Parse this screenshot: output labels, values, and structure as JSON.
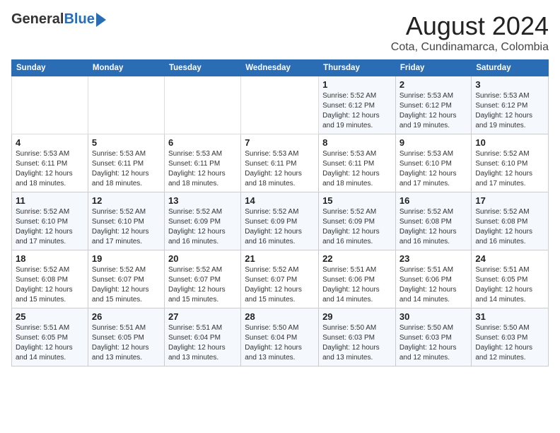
{
  "header": {
    "logo_general": "General",
    "logo_blue": "Blue",
    "title": "August 2024",
    "subtitle": "Cota, Cundinamarca, Colombia"
  },
  "weekdays": [
    "Sunday",
    "Monday",
    "Tuesday",
    "Wednesday",
    "Thursday",
    "Friday",
    "Saturday"
  ],
  "weeks": [
    [
      {
        "day": "",
        "detail": ""
      },
      {
        "day": "",
        "detail": ""
      },
      {
        "day": "",
        "detail": ""
      },
      {
        "day": "",
        "detail": ""
      },
      {
        "day": "1",
        "detail": "Sunrise: 5:52 AM\nSunset: 6:12 PM\nDaylight: 12 hours\nand 19 minutes."
      },
      {
        "day": "2",
        "detail": "Sunrise: 5:53 AM\nSunset: 6:12 PM\nDaylight: 12 hours\nand 19 minutes."
      },
      {
        "day": "3",
        "detail": "Sunrise: 5:53 AM\nSunset: 6:12 PM\nDaylight: 12 hours\nand 19 minutes."
      }
    ],
    [
      {
        "day": "4",
        "detail": "Sunrise: 5:53 AM\nSunset: 6:11 PM\nDaylight: 12 hours\nand 18 minutes."
      },
      {
        "day": "5",
        "detail": "Sunrise: 5:53 AM\nSunset: 6:11 PM\nDaylight: 12 hours\nand 18 minutes."
      },
      {
        "day": "6",
        "detail": "Sunrise: 5:53 AM\nSunset: 6:11 PM\nDaylight: 12 hours\nand 18 minutes."
      },
      {
        "day": "7",
        "detail": "Sunrise: 5:53 AM\nSunset: 6:11 PM\nDaylight: 12 hours\nand 18 minutes."
      },
      {
        "day": "8",
        "detail": "Sunrise: 5:53 AM\nSunset: 6:11 PM\nDaylight: 12 hours\nand 18 minutes."
      },
      {
        "day": "9",
        "detail": "Sunrise: 5:53 AM\nSunset: 6:10 PM\nDaylight: 12 hours\nand 17 minutes."
      },
      {
        "day": "10",
        "detail": "Sunrise: 5:52 AM\nSunset: 6:10 PM\nDaylight: 12 hours\nand 17 minutes."
      }
    ],
    [
      {
        "day": "11",
        "detail": "Sunrise: 5:52 AM\nSunset: 6:10 PM\nDaylight: 12 hours\nand 17 minutes."
      },
      {
        "day": "12",
        "detail": "Sunrise: 5:52 AM\nSunset: 6:10 PM\nDaylight: 12 hours\nand 17 minutes."
      },
      {
        "day": "13",
        "detail": "Sunrise: 5:52 AM\nSunset: 6:09 PM\nDaylight: 12 hours\nand 16 minutes."
      },
      {
        "day": "14",
        "detail": "Sunrise: 5:52 AM\nSunset: 6:09 PM\nDaylight: 12 hours\nand 16 minutes."
      },
      {
        "day": "15",
        "detail": "Sunrise: 5:52 AM\nSunset: 6:09 PM\nDaylight: 12 hours\nand 16 minutes."
      },
      {
        "day": "16",
        "detail": "Sunrise: 5:52 AM\nSunset: 6:08 PM\nDaylight: 12 hours\nand 16 minutes."
      },
      {
        "day": "17",
        "detail": "Sunrise: 5:52 AM\nSunset: 6:08 PM\nDaylight: 12 hours\nand 16 minutes."
      }
    ],
    [
      {
        "day": "18",
        "detail": "Sunrise: 5:52 AM\nSunset: 6:08 PM\nDaylight: 12 hours\nand 15 minutes."
      },
      {
        "day": "19",
        "detail": "Sunrise: 5:52 AM\nSunset: 6:07 PM\nDaylight: 12 hours\nand 15 minutes."
      },
      {
        "day": "20",
        "detail": "Sunrise: 5:52 AM\nSunset: 6:07 PM\nDaylight: 12 hours\nand 15 minutes."
      },
      {
        "day": "21",
        "detail": "Sunrise: 5:52 AM\nSunset: 6:07 PM\nDaylight: 12 hours\nand 15 minutes."
      },
      {
        "day": "22",
        "detail": "Sunrise: 5:51 AM\nSunset: 6:06 PM\nDaylight: 12 hours\nand 14 minutes."
      },
      {
        "day": "23",
        "detail": "Sunrise: 5:51 AM\nSunset: 6:06 PM\nDaylight: 12 hours\nand 14 minutes."
      },
      {
        "day": "24",
        "detail": "Sunrise: 5:51 AM\nSunset: 6:05 PM\nDaylight: 12 hours\nand 14 minutes."
      }
    ],
    [
      {
        "day": "25",
        "detail": "Sunrise: 5:51 AM\nSunset: 6:05 PM\nDaylight: 12 hours\nand 14 minutes."
      },
      {
        "day": "26",
        "detail": "Sunrise: 5:51 AM\nSunset: 6:05 PM\nDaylight: 12 hours\nand 13 minutes."
      },
      {
        "day": "27",
        "detail": "Sunrise: 5:51 AM\nSunset: 6:04 PM\nDaylight: 12 hours\nand 13 minutes."
      },
      {
        "day": "28",
        "detail": "Sunrise: 5:50 AM\nSunset: 6:04 PM\nDaylight: 12 hours\nand 13 minutes."
      },
      {
        "day": "29",
        "detail": "Sunrise: 5:50 AM\nSunset: 6:03 PM\nDaylight: 12 hours\nand 13 minutes."
      },
      {
        "day": "30",
        "detail": "Sunrise: 5:50 AM\nSunset: 6:03 PM\nDaylight: 12 hours\nand 12 minutes."
      },
      {
        "day": "31",
        "detail": "Sunrise: 5:50 AM\nSunset: 6:03 PM\nDaylight: 12 hours\nand 12 minutes."
      }
    ]
  ]
}
